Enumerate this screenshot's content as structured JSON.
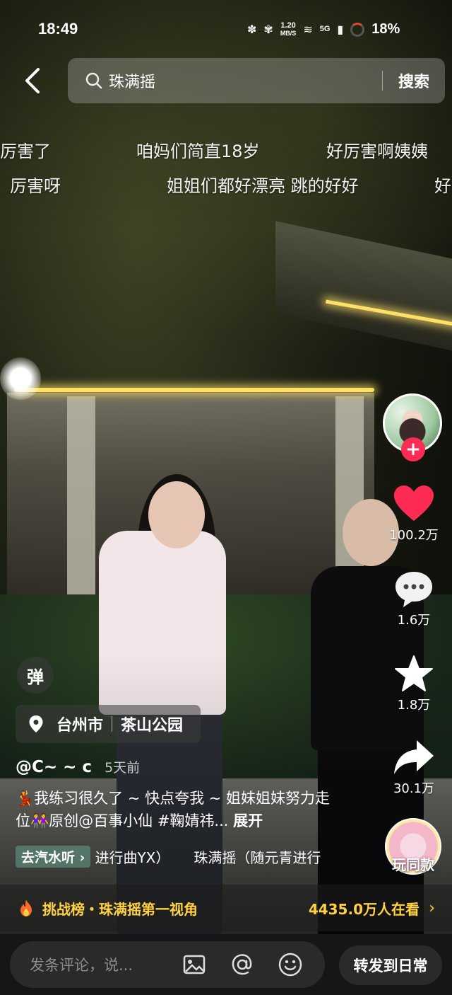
{
  "status_bar": {
    "time": "18:49",
    "net_speed_value": "1.20",
    "net_speed_unit": "MB/S",
    "network": "5G",
    "battery": "18%"
  },
  "search": {
    "query": "珠满摇",
    "submit_label": "搜索"
  },
  "danmaku": [
    "厉害了",
    "咱妈们简直18岁",
    "好厉害啊姨姨",
    "厉害呀",
    "姐姐们都好漂亮 跳的好好",
    "好"
  ],
  "right_rail": {
    "likes": "100.2万",
    "comments": "1.6万",
    "favorites": "1.8万",
    "shares": "30.1万",
    "music_label": "玩同款",
    "follow_symbol": "+"
  },
  "overlay": {
    "danmu_toggle": "弹",
    "location_city": "台州市",
    "location_place": "茶山公园",
    "author": "@C~ ~ c",
    "posted": "5天前",
    "caption": "💃我练习很久了 ~ 快点夸我 ~ 姐妹姐妹努力走位👭原创@百事小仙 #鞠婧祎...",
    "expand": "展开",
    "listen_tag": "去汽水听",
    "music_title_1": "进行曲YX）",
    "music_title_2": "珠满摇（随元青进行"
  },
  "challenge": {
    "text": "挑战榜・珠满摇第一视角",
    "count": "4435.0万人在看"
  },
  "bottom_bar": {
    "comment_placeholder": "发条评论，说...",
    "share_label": "转发到日常"
  },
  "colors": {
    "like": "#fe2c55",
    "challenge_gold": "#ffd140",
    "bottom_bg": "#161616"
  },
  "icons": [
    "back-arrow-icon",
    "search-icon",
    "location-pin-icon",
    "heart-icon",
    "comment-icon",
    "star-icon",
    "share-arrow-icon",
    "fire-icon",
    "image-icon",
    "at-icon",
    "emoji-icon"
  ]
}
